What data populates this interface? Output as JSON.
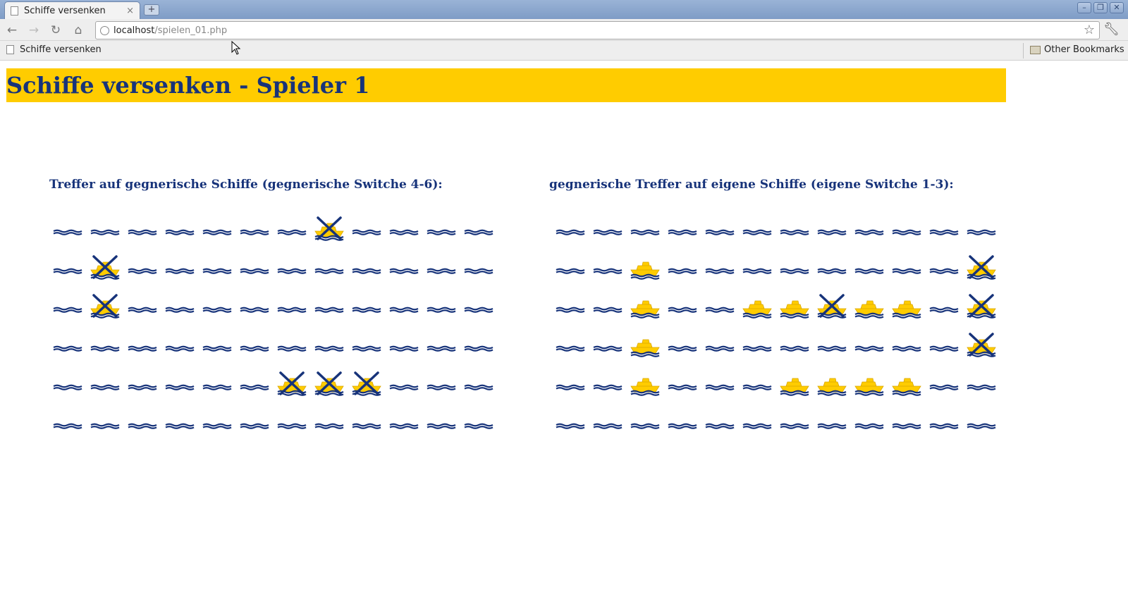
{
  "browser": {
    "tab_title": "Schiffe versenken",
    "tab_close": "×",
    "new_tab": "+",
    "url_host": "localhost",
    "url_path": "/spielen_01.php",
    "bookmark_label": "Schiffe versenken",
    "other_bookmarks": "Other Bookmarks",
    "window_buttons": {
      "minimize": "–",
      "restore": "❐",
      "close": "✕"
    }
  },
  "page": {
    "title": "Schiffe versenken - Spieler 1"
  },
  "boards": {
    "left": {
      "heading": "Treffer auf gegnerische Schiffe (gegnerische Switche 4-6):",
      "rows": [
        [
          "W",
          "W",
          "W",
          "W",
          "W",
          "W",
          "W",
          "X",
          "W",
          "W",
          "W",
          "W"
        ],
        [
          "W",
          "X",
          "W",
          "W",
          "W",
          "W",
          "W",
          "W",
          "W",
          "W",
          "W",
          "W"
        ],
        [
          "W",
          "X",
          "W",
          "W",
          "W",
          "W",
          "W",
          "W",
          "W",
          "W",
          "W",
          "W"
        ],
        [
          "W",
          "W",
          "W",
          "W",
          "W",
          "W",
          "W",
          "W",
          "W",
          "W",
          "W",
          "W"
        ],
        [
          "W",
          "W",
          "W",
          "W",
          "W",
          "W",
          "X",
          "X",
          "X",
          "W",
          "W",
          "W"
        ],
        [
          "W",
          "W",
          "W",
          "W",
          "W",
          "W",
          "W",
          "W",
          "W",
          "W",
          "W",
          "W"
        ]
      ]
    },
    "right": {
      "heading": "gegnerische Treffer auf eigene Schiffe (eigene Switche 1-3):",
      "rows": [
        [
          "W",
          "W",
          "W",
          "W",
          "W",
          "W",
          "W",
          "W",
          "W",
          "W",
          "W",
          "W"
        ],
        [
          "W",
          "W",
          "S",
          "W",
          "W",
          "W",
          "W",
          "W",
          "W",
          "W",
          "W",
          "X"
        ],
        [
          "W",
          "W",
          "S",
          "W",
          "W",
          "S",
          "S",
          "X",
          "S",
          "S",
          "W",
          "X"
        ],
        [
          "W",
          "W",
          "S",
          "W",
          "W",
          "W",
          "W",
          "W",
          "W",
          "W",
          "W",
          "X"
        ],
        [
          "W",
          "W",
          "S",
          "W",
          "W",
          "W",
          "S",
          "S",
          "S",
          "S",
          "W",
          "W"
        ],
        [
          "W",
          "W",
          "W",
          "W",
          "W",
          "W",
          "W",
          "W",
          "W",
          "W",
          "W",
          "W"
        ]
      ]
    }
  },
  "legend_codes": {
    "W": "water",
    "S": "ship",
    "X": "hit-ship"
  },
  "colors": {
    "header_bg": "#ffcc00",
    "title_text": "#17337a",
    "water": "#17337a",
    "ship": "#ffcc00"
  }
}
